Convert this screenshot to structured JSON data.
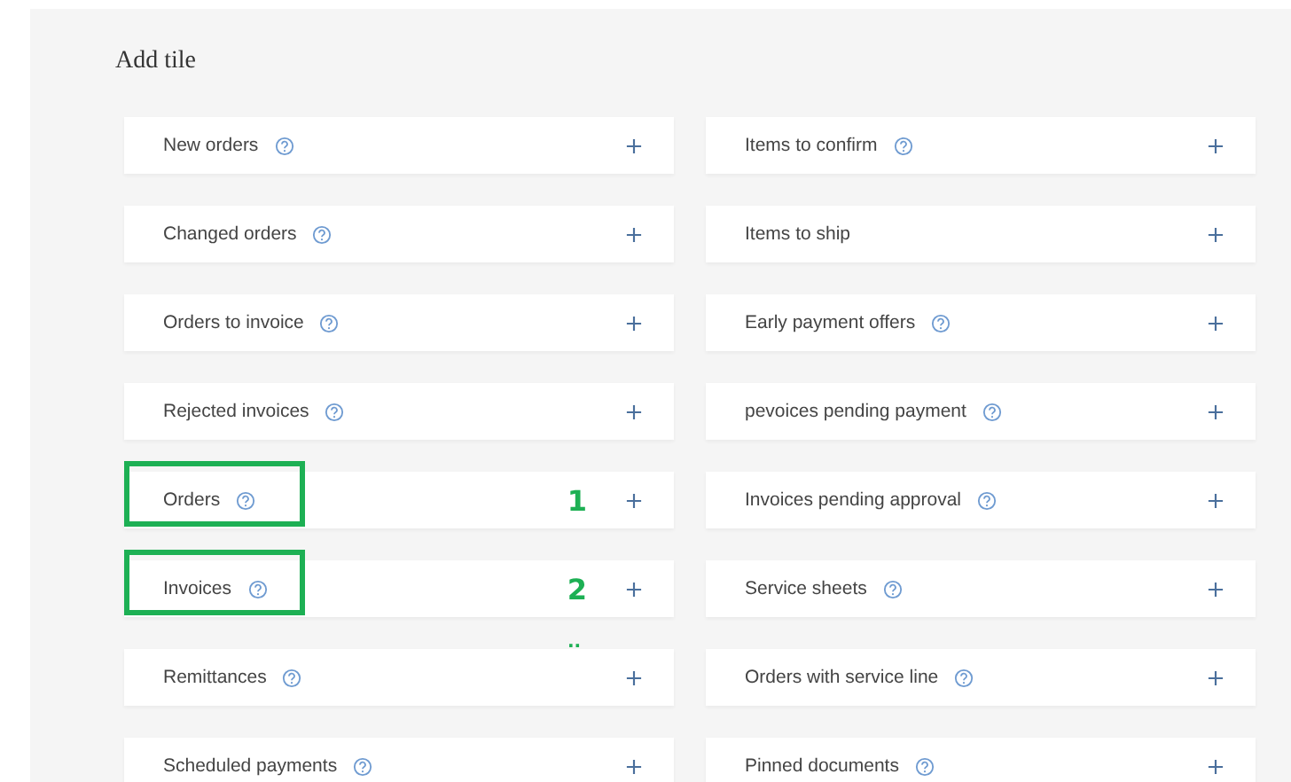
{
  "title": "Add tile",
  "tiles": [
    {
      "label": "New orders",
      "help": true,
      "highlighted": false
    },
    {
      "label": "Items to confirm",
      "help": true,
      "highlighted": false
    },
    {
      "label": "Changed orders",
      "help": true,
      "highlighted": false
    },
    {
      "label": "Items to ship",
      "help": false,
      "highlighted": false
    },
    {
      "label": "Orders to invoice",
      "help": true,
      "highlighted": false
    },
    {
      "label": "Early payment offers",
      "help": true,
      "highlighted": false
    },
    {
      "label": "Rejected invoices",
      "help": true,
      "highlighted": false
    },
    {
      "label": "pevoices pending payment",
      "help": true,
      "highlighted": false
    },
    {
      "label": "Orders",
      "help": true,
      "highlighted": true,
      "marker": "1"
    },
    {
      "label": "Invoices pending approval",
      "help": true,
      "highlighted": false
    },
    {
      "label": "Invoices",
      "help": true,
      "highlighted": true,
      "marker": "2"
    },
    {
      "label": "Service sheets",
      "help": true,
      "highlighted": false
    },
    {
      "label": "Remittances",
      "help": true,
      "highlighted": false,
      "note_above": ".."
    },
    {
      "label": "Orders with service line",
      "help": true,
      "highlighted": false
    },
    {
      "label": "Scheduled payments",
      "help": true,
      "highlighted": false
    },
    {
      "label": "Pinned documents",
      "help": true,
      "highlighted": false
    }
  ]
}
